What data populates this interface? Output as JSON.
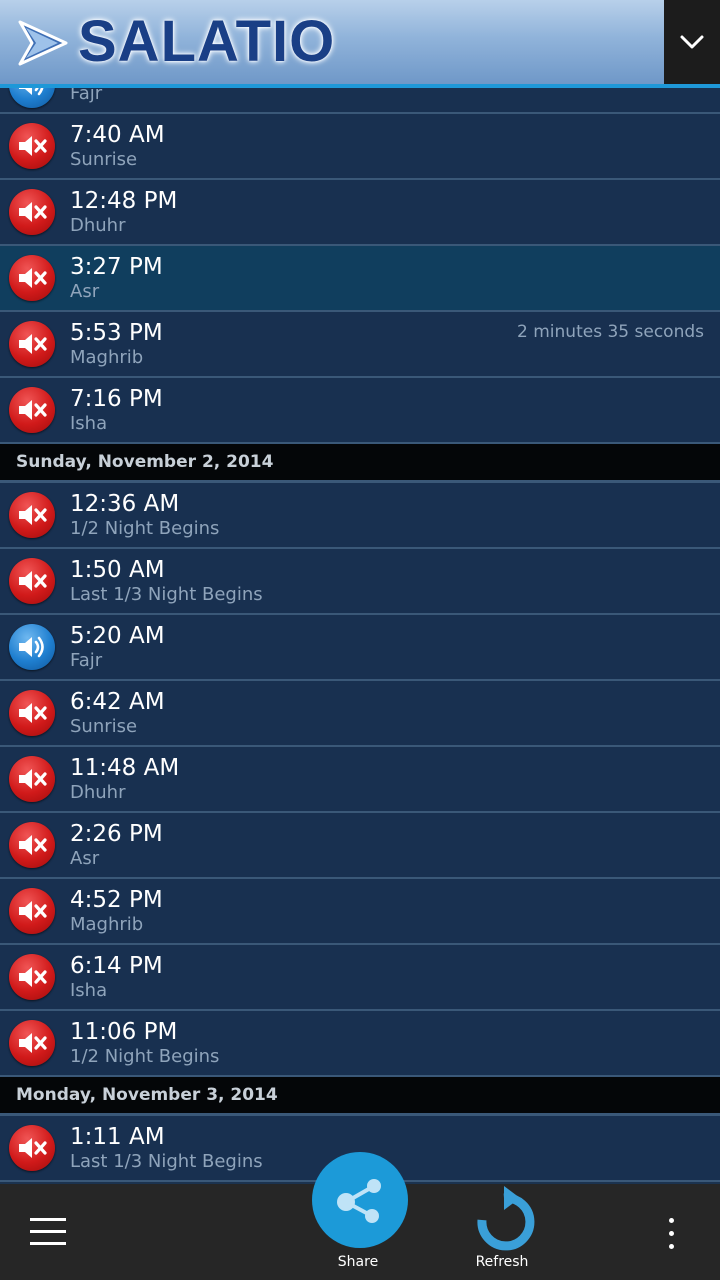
{
  "app": {
    "title": "SALATIO"
  },
  "colors": {
    "accent": "#1e98d8",
    "muted_bell": "#d11a1a",
    "active_bell": "#1f7fd0"
  },
  "list": {
    "partial_top": {
      "name": "Fajr",
      "state": "on"
    },
    "group1": [
      {
        "time": "7:40 AM",
        "name": "Sunrise",
        "state": "muted"
      },
      {
        "time": "12:48 PM",
        "name": "Dhuhr",
        "state": "muted"
      },
      {
        "time": "3:27 PM",
        "name": "Asr",
        "state": "muted",
        "selected": true
      },
      {
        "time": "5:53 PM",
        "name": "Maghrib",
        "state": "muted",
        "countdown": "2 minutes 35 seconds"
      },
      {
        "time": "7:16 PM",
        "name": "Isha",
        "state": "muted"
      }
    ],
    "date2": "Sunday, November 2, 2014",
    "group2": [
      {
        "time": "12:36 AM",
        "name": "1/2 Night Begins",
        "state": "muted"
      },
      {
        "time": "1:50 AM",
        "name": "Last 1/3 Night Begins",
        "state": "muted"
      },
      {
        "time": "5:20 AM",
        "name": "Fajr",
        "state": "on"
      },
      {
        "time": "6:42 AM",
        "name": "Sunrise",
        "state": "muted"
      },
      {
        "time": "11:48 AM",
        "name": "Dhuhr",
        "state": "muted"
      },
      {
        "time": "2:26 PM",
        "name": "Asr",
        "state": "muted"
      },
      {
        "time": "4:52 PM",
        "name": "Maghrib",
        "state": "muted"
      },
      {
        "time": "6:14 PM",
        "name": "Isha",
        "state": "muted"
      },
      {
        "time": "11:06 PM",
        "name": "1/2 Night Begins",
        "state": "muted"
      }
    ],
    "date3": "Monday, November 3, 2014",
    "group3": [
      {
        "time": "1:11 AM",
        "name": "Last 1/3 Night Begins",
        "state": "muted"
      }
    ]
  },
  "action_bar": {
    "share_label": "Share",
    "refresh_label": "Refresh"
  },
  "icons": {
    "menu": "hamburger-icon",
    "share": "share-icon",
    "refresh": "refresh-icon",
    "overflow": "overflow-icon",
    "dropdown": "chevron-down-icon",
    "muted": "speaker-muted-icon",
    "on": "speaker-on-icon"
  }
}
